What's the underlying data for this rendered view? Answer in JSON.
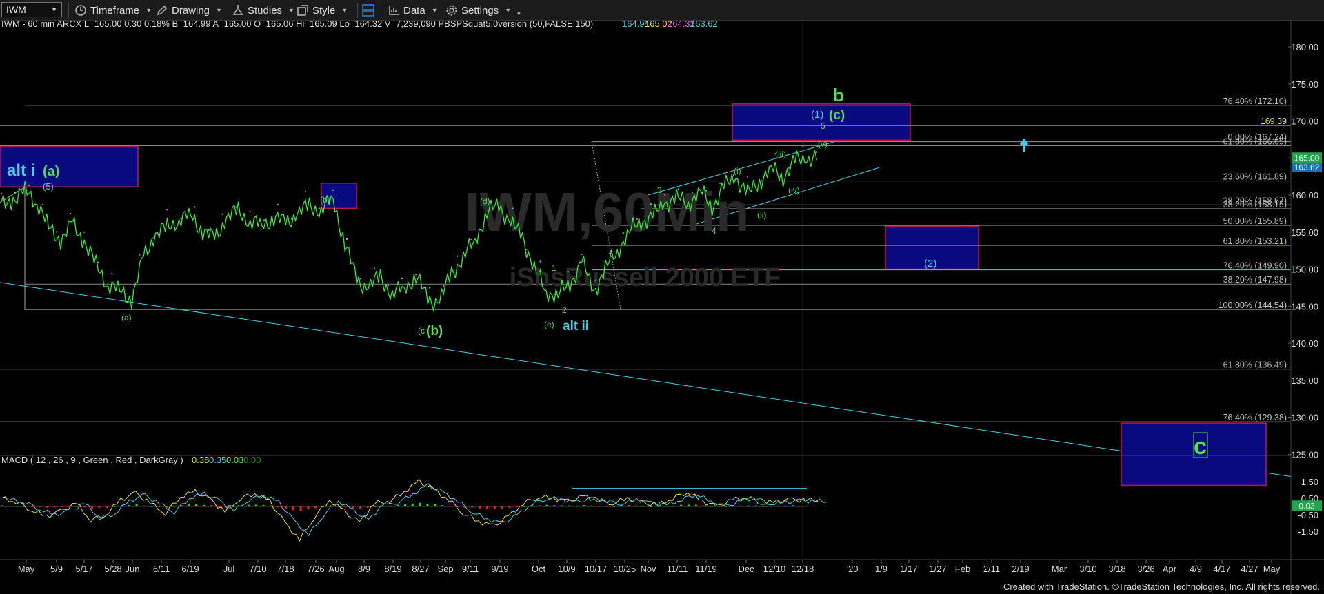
{
  "toolbar": {
    "symbol": "IWM",
    "timeframe_label": "Timeframe",
    "drawing_label": "Drawing",
    "studies_label": "Studies",
    "style_label": "Style",
    "data_label": "Data",
    "settings_label": "Settings"
  },
  "header": {
    "info": "IWM - 60 min  ARCX  L=165.00  0.30  0.18%  B=164.99  A=165.00  O=165.06  Hi=165.09  Lo=164.32  V=7,239,090  PBSPSquat5.0version (50,FALSE,150)",
    "values": [
      "164.94",
      "165.02",
      "164.32",
      "163.62"
    ],
    "value_colors": [
      "#4fd0e6",
      "#e6e34f",
      "#e05ce0",
      "#4fd0e6"
    ]
  },
  "macd_header": {
    "label": "MACD ( 12 , 26 , 9 , Green , Red , DarkGray )",
    "values": [
      "0.38",
      "0.35",
      "0.03",
      "0.00"
    ],
    "value_colors": [
      "#e6e34f",
      "#4fd0e6",
      "#5ef05e",
      "#2a8a2a"
    ]
  },
  "watermark": {
    "symbol": "IWM,60Min",
    "name": "iShsRussell 2000 ETF"
  },
  "footer": "Created with TradeStation. ©TradeStation Technologies, Inc. All rights reserved.",
  "colors": {
    "bg": "#000000",
    "price": "#33ee33",
    "cyan": "#45d1e6",
    "box_fill": "#0a0a80",
    "box_border": "#c0154a",
    "fib_text": "#bbbbbb",
    "green_label": "#55dd55",
    "blue_label": "#4fc8e8",
    "macd_hist_pos": "#22dd22",
    "macd_hist_neg": "#ee2222"
  },
  "chart_data": {
    "type": "line",
    "title": "IWM - 60 min",
    "price_axis": {
      "ticks": [
        "180.00",
        "175.00",
        "170.00",
        "165.00",
        "160.00",
        "155.00",
        "150.00",
        "145.00",
        "140.00",
        "135.00",
        "130.00",
        "125.00"
      ],
      "range": [
        121,
        181
      ]
    },
    "macd_axis": {
      "ticks": [
        "1.50",
        "0.50",
        "-0.50",
        "-1.50"
      ],
      "range": [
        -2.2,
        2.0
      ]
    },
    "x_labels": [
      "May",
      "5/9",
      "5/17",
      "5/28",
      "Jun",
      "6/11",
      "6/19",
      "Jul",
      "7/10",
      "7/18",
      "7/26",
      "Aug",
      "8/9",
      "8/19",
      "8/27",
      "Sep",
      "9/11",
      "9/19",
      "Oct",
      "10/9",
      "10/17",
      "10/25",
      "Nov",
      "11/11",
      "11/19",
      "Dec",
      "12/10",
      "12/18",
      "'20",
      "1/9",
      "1/17",
      "1/27",
      "Feb",
      "2/11",
      "2/19",
      "Mar",
      "3/10",
      "3/18",
      "3/26",
      "Apr",
      "4/9",
      "4/17",
      "4/27",
      "May"
    ],
    "price_series": {
      "name": "IWM",
      "values": [
        158.5,
        159.5,
        160.5,
        159.2,
        155.5,
        154.0,
        156.0,
        153.8,
        150.5,
        148.0,
        147.0,
        146.0,
        151.5,
        154.8,
        155.5,
        156.8,
        157.2,
        155.2,
        154.0,
        157.0,
        157.8,
        156.5,
        155.8,
        157.0,
        156.2,
        157.5,
        158.5,
        158.0,
        159.5,
        153.5,
        148.5,
        147.5,
        149.0,
        146.5,
        147.5,
        149.0,
        146.0,
        145.5,
        149.5,
        151.5,
        154.0,
        157.5,
        158.8,
        156.0,
        154.5,
        150.0,
        147.0,
        146.5,
        148.0,
        151.0,
        147.0,
        150.0,
        152.5,
        155.0,
        156.5,
        157.0,
        159.0,
        159.5,
        159.0,
        160.5,
        158.5,
        161.0,
        162.5,
        160.0,
        162.0,
        163.5,
        162.5,
        164.5,
        165.0
      ]
    },
    "macd_series": {
      "macd": [
        0.5,
        0.3,
        -0.2,
        -0.6,
        -0.3,
        0.2,
        -0.8,
        -0.5,
        0.4,
        0.8,
        0.2,
        -0.4,
        0.6,
        0.9,
        0.4,
        -0.3,
        0.5,
        0.8,
        0.3,
        -1.0,
        -2.0,
        -0.6,
        0.4,
        -0.3,
        -1.0,
        0.2,
        0.3,
        0.9,
        1.5,
        1.0,
        0.4,
        -0.4,
        -0.9,
        -1.2,
        -0.6,
        0.2,
        0.6,
        0.5,
        0.3,
        0.6,
        0.4,
        0.2,
        0.5,
        0.2,
        0.1,
        0.5,
        0.9,
        0.3,
        0.0,
        0.4,
        0.6,
        0.2,
        0.3,
        0.4,
        0.38
      ]
    },
    "fib_levels": [
      {
        "label": "76.40% (172.10)",
        "value": 172.1
      },
      {
        "label": "169.39",
        "value": 169.39
      },
      {
        "label": "0.00% (167.24)",
        "value": 167.24
      },
      {
        "label": "61.80% (166.65)",
        "value": 166.65
      },
      {
        "label": "23.60% (161.89)",
        "value": 161.89
      },
      {
        "label": "38.20% (158.67)",
        "value": 158.67
      },
      {
        "label": "38.20% (158.15)",
        "value": 158.15
      },
      {
        "label": "50.00% (155.89)",
        "value": 155.89
      },
      {
        "label": "61.80% (153.21)",
        "value": 153.21
      },
      {
        "label": "76.40% (149.90)",
        "value": 149.9
      },
      {
        "label": "38.20% (147.98)",
        "value": 147.98
      },
      {
        "label": "100.00% (144.54)",
        "value": 144.54
      },
      {
        "label": "0.00% (144.54)",
        "value": 144.54
      },
      {
        "label": "61.80% (136.49)",
        "value": 136.49
      },
      {
        "label": "76.40% (129.38)",
        "value": 129.38
      }
    ],
    "last_price": "165.00",
    "last_price_2": "163.62",
    "macd_last": "0.03",
    "wave_labels": [
      {
        "text": "alt i",
        "color": "blue",
        "size": "big"
      },
      {
        "text": "(a)",
        "color": "green",
        "size": "big"
      },
      {
        "text": "(5)",
        "color": "blue",
        "size": "small"
      },
      {
        "text": "(b)",
        "color": "green",
        "size": "small"
      },
      {
        "text": "(a)",
        "color": "green",
        "size": "small"
      },
      {
        "text": "(c",
        "color": "green",
        "size": "small"
      },
      {
        "text": "(b)",
        "color": "green",
        "size": "big"
      },
      {
        "text": "(d)",
        "color": "green",
        "size": "small"
      },
      {
        "text": "1",
        "color": "green",
        "size": "small"
      },
      {
        "text": "2",
        "color": "green",
        "size": "small"
      },
      {
        "text": "(e)",
        "color": "green",
        "size": "small"
      },
      {
        "text": "alt ii",
        "color": "blue",
        "size": "big"
      },
      {
        "text": "3",
        "color": "green",
        "size": "small"
      },
      {
        "text": "4",
        "color": "green",
        "size": "small"
      },
      {
        "text": "(i)",
        "color": "green",
        "size": "small"
      },
      {
        "text": "(ii)",
        "color": "green",
        "size": "small"
      },
      {
        "text": "(iii)",
        "color": "green",
        "size": "small"
      },
      {
        "text": "(iv)",
        "color": "green",
        "size": "small"
      },
      {
        "text": "(v)",
        "color": "green",
        "size": "small"
      },
      {
        "text": "(1)",
        "color": "blue",
        "size": "med"
      },
      {
        "text": "5",
        "color": "green",
        "size": "small"
      },
      {
        "text": "(c)",
        "color": "green",
        "size": "big"
      },
      {
        "text": "b",
        "color": "green",
        "size": "huge"
      },
      {
        "text": "(2)",
        "color": "blue",
        "size": "med"
      },
      {
        "text": "c",
        "color": "green",
        "size": "huge"
      }
    ]
  }
}
